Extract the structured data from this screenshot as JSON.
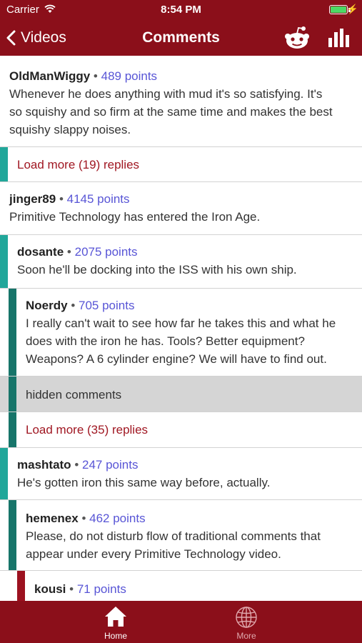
{
  "status": {
    "carrier": "Carrier",
    "time": "8:54 PM"
  },
  "nav": {
    "back_label": "Videos",
    "title": "Comments"
  },
  "colors": {
    "brand": "#8b0f1a",
    "depth1": "#21a79a",
    "depth2": "#17756a",
    "depth3": "#9c1220",
    "points": "#5855d6",
    "load_more": "#a01722"
  },
  "comments": [
    {
      "author": "OldManWiggy",
      "points": "489 points",
      "lines": [
        "Whenever he does anything with mud it's so satisfying. It's",
        "so squishy and so firm at the same time and makes the best",
        "squishy slappy noises."
      ]
    },
    {
      "load_more": "Load more (19) replies"
    },
    {
      "author": "jinger89",
      "points": "4145 points",
      "lines": [
        "Primitive Technology has entered the Iron Age."
      ]
    },
    {
      "author": "dosante",
      "points": "2075 points",
      "lines": [
        "Soon he'll be docking into the ISS with his own ship."
      ]
    },
    {
      "author": "Noerdy",
      "points": "705 points",
      "lines": [
        "I really can't wait to see how far he takes this and what he",
        "does with the iron he has. Tools? Better equipment?",
        "Weapons? A 6 cylinder engine? We will have to find out."
      ]
    },
    {
      "hidden_label": "hidden comments"
    },
    {
      "load_more": "Load more (35) replies"
    },
    {
      "author": "mashtato",
      "points": "247 points",
      "lines": [
        "He's gotten iron this same way before, actually."
      ]
    },
    {
      "author": "hemenex",
      "points": "462 points",
      "lines": [
        "Please, do not disturb flow of traditional comments that",
        "appear under every Primitive Technology video."
      ]
    },
    {
      "author": "kousi",
      "points": "71 points",
      "lines": []
    }
  ],
  "tabs": [
    {
      "label": "Home",
      "icon": "home-icon",
      "selected": true
    },
    {
      "label": "More",
      "icon": "globe-icon",
      "selected": false
    }
  ]
}
